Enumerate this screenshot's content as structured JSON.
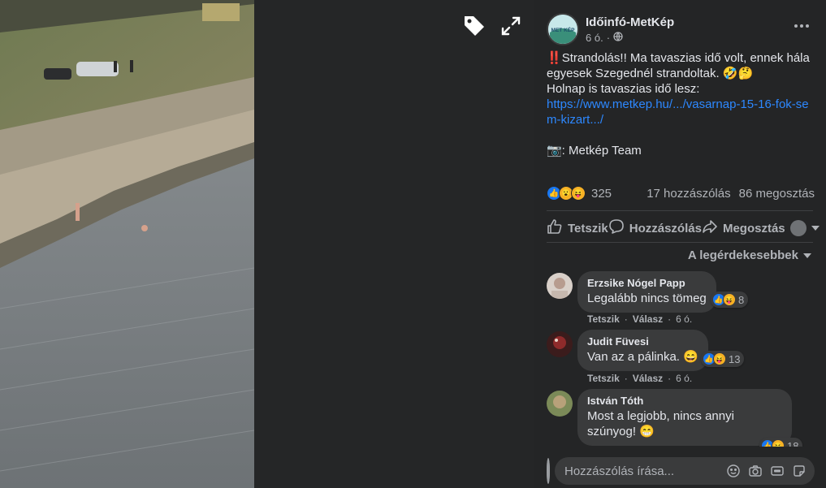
{
  "viewer": {
    "tag_icon": "tag-icon",
    "expand_icon": "expand-icon"
  },
  "post": {
    "page_name": "Időinfó-MetKép",
    "time": "6 ó.",
    "privacy_icon": "globe-icon",
    "text_line1_bang": "‼️",
    "text_line1": "Strandolás!! Ma tavaszias idő volt, ennek hála egyesek Szegednél strandoltak. 🤣🤔",
    "text_line2": "Holnap is tavaszias idő lesz:",
    "link": "https://www.metkep.hu/.../vasarnap-15-16-fok-sem-kizart.../",
    "credit": "📷: Metkép Team",
    "avatar_logo_text": "MET KÉP"
  },
  "stats": {
    "reaction_count": "325",
    "comments": "17 hozzászólás",
    "shares": "86 megosztás"
  },
  "actions": {
    "like": "Tetszik",
    "comment": "Hozzászólás",
    "share": "Megosztás"
  },
  "sort": {
    "label": "A legérdekesebbek"
  },
  "comments": [
    {
      "name": "Erzsike Nógel Papp",
      "text": "Legalább nincs tömeg",
      "reactions": "8",
      "like": "Tetszik",
      "reply": "Válasz",
      "time": "6 ó."
    },
    {
      "name": "Judit Füvesi",
      "text": "Van az a pálinka. 😄",
      "reactions": "13",
      "like": "Tetszik",
      "reply": "Válasz",
      "time": "6 ó."
    },
    {
      "name": "István Tóth",
      "text": "Most a legjobb, nincs annyi szúnyog! 😁",
      "reactions": "18"
    }
  ],
  "composer": {
    "placeholder": "Hozzászólás írása..."
  },
  "colors": {
    "panel_bg": "#242526",
    "bubble_bg": "#3a3b3c",
    "link": "#2d88ff",
    "like_blue": "#1877f2"
  }
}
